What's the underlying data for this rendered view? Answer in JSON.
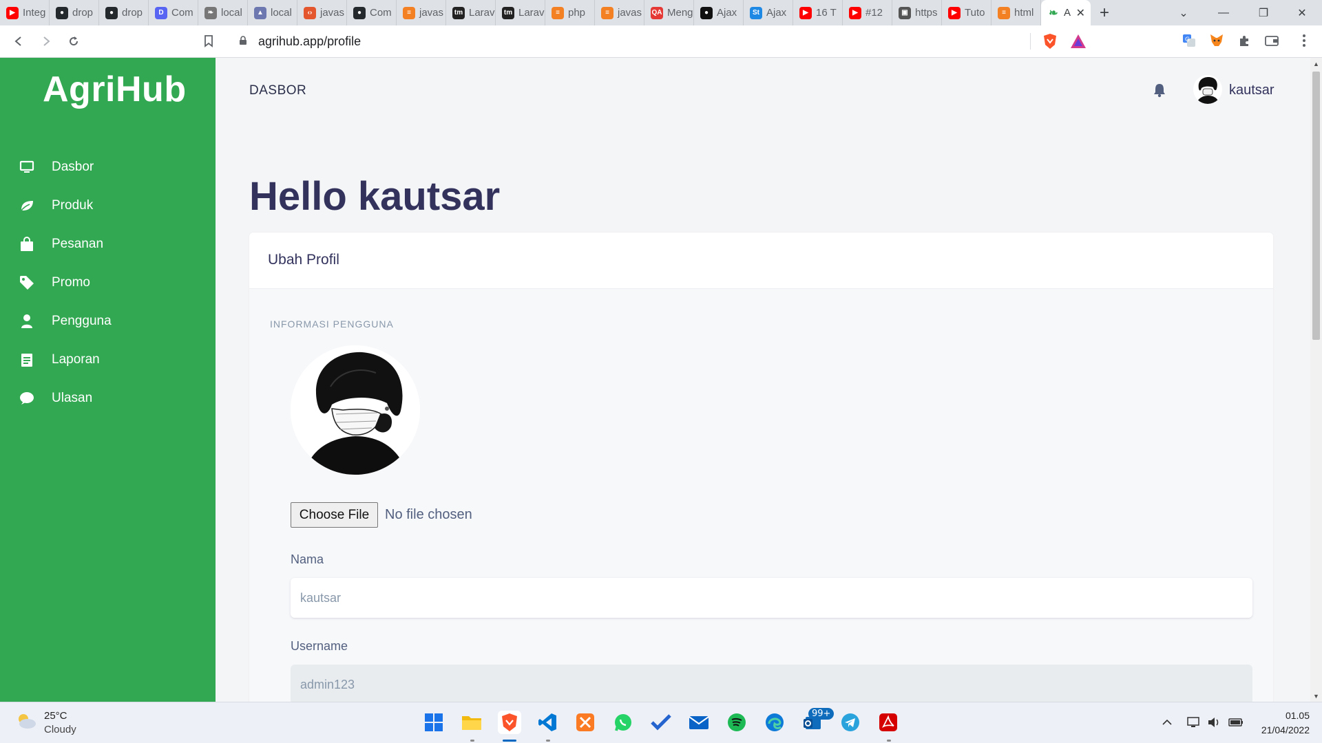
{
  "browser": {
    "tabs": [
      {
        "label": "Integ",
        "icon": "youtube-icon",
        "color": "#ff0000"
      },
      {
        "label": "drop",
        "icon": "github-icon",
        "color": "#24292e"
      },
      {
        "label": "drop",
        "icon": "github-icon",
        "color": "#24292e"
      },
      {
        "label": "Com",
        "icon": "discord-icon",
        "color": "#5865f2"
      },
      {
        "label": "local",
        "icon": "leaf-icon",
        "color": "#777777"
      },
      {
        "label": "local",
        "icon": "phpmyadmin-icon",
        "color": "#6c78af"
      },
      {
        "label": "javas",
        "icon": "code-icon",
        "color": "#e4572e"
      },
      {
        "label": "Com",
        "icon": "github-icon",
        "color": "#24292e"
      },
      {
        "label": "javas",
        "icon": "stackoverflow-icon",
        "color": "#f48024"
      },
      {
        "label": "Larav",
        "icon": "tm-icon",
        "color": "#222222"
      },
      {
        "label": "Larav",
        "icon": "tm-icon",
        "color": "#222222"
      },
      {
        "label": "php",
        "icon": "stackoverflow-icon",
        "color": "#f48024"
      },
      {
        "label": "javas",
        "icon": "stackoverflow-icon",
        "color": "#f48024"
      },
      {
        "label": "Meng",
        "icon": "qa-icon",
        "color": "#e53935"
      },
      {
        "label": "Ajax",
        "icon": "circle-icon",
        "color": "#111111"
      },
      {
        "label": "Ajax",
        "icon": "st-icon",
        "color": "#1e88e5"
      },
      {
        "label": "16 T",
        "icon": "youtube-icon",
        "color": "#ff0000"
      },
      {
        "label": "#12",
        "icon": "youtube-icon",
        "color": "#ff0000"
      },
      {
        "label": "https",
        "icon": "page-icon",
        "color": "#555555"
      },
      {
        "label": "Tuto",
        "icon": "youtube-icon",
        "color": "#ff0000"
      },
      {
        "label": "html",
        "icon": "stackoverflow-icon",
        "color": "#f48024"
      }
    ],
    "active_tab": {
      "label": "A",
      "icon": "leaf-icon",
      "color": "#32a852"
    },
    "url": "agrihub.app/profile"
  },
  "app": {
    "brand": "AgriHub",
    "accent_color": "#32a852",
    "sidebar": {
      "items": [
        {
          "label": "Dasbor",
          "icon": "monitor-icon"
        },
        {
          "label": "Produk",
          "icon": "leaf-icon"
        },
        {
          "label": "Pesanan",
          "icon": "shopping-bag-icon"
        },
        {
          "label": "Promo",
          "icon": "tag-icon"
        },
        {
          "label": "Pengguna",
          "icon": "user-icon"
        },
        {
          "label": "Laporan",
          "icon": "report-icon"
        },
        {
          "label": "Ulasan",
          "icon": "chat-bubble-icon"
        }
      ]
    },
    "topnav": {
      "title": "DASBOR",
      "username": "kautsar"
    },
    "greeting": "Hello kautsar",
    "card": {
      "title": "Ubah Profil",
      "section_label": "INFORMASI PENGGUNA",
      "file_button": "Choose File",
      "file_status": "No file chosen",
      "fields": {
        "nama_label": "Nama",
        "nama_value": "kautsar",
        "username_label": "Username",
        "username_value": "admin123"
      }
    }
  },
  "taskbar": {
    "weather_temp": "25°C",
    "weather_desc": "Cloudy",
    "time": "01.05",
    "date": "21/04/2022",
    "mail_badge": "99+"
  }
}
